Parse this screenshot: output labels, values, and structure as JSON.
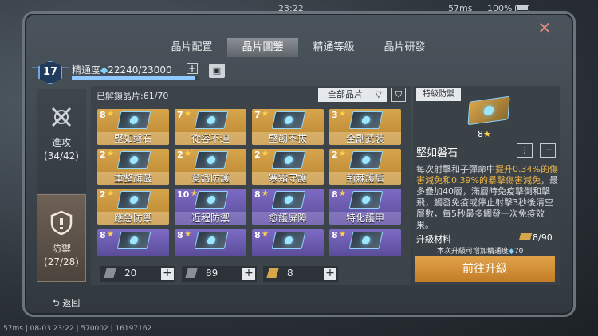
{
  "status": {
    "time": "23:22",
    "network": "57ms",
    "battery": "100%"
  },
  "tabs": [
    "晶片配置",
    "晶片圖鑒",
    "精通等級",
    "晶片研發"
  ],
  "active_tab": 1,
  "level": "17",
  "mastery": {
    "label": "精通度",
    "value": "22240/23000",
    "progress": 0.967
  },
  "categories": [
    {
      "name": "進攻",
      "count": "(34/42)"
    },
    {
      "name": "防禦",
      "count": "(27/28)"
    }
  ],
  "unlocked": "已解鎖晶片:61/70",
  "filter": "全部晶片",
  "chips": [
    {
      "level": "8",
      "name": "堅如磐石",
      "color": "gold"
    },
    {
      "level": "7",
      "name": "從容不迫",
      "color": "gold"
    },
    {
      "level": "7",
      "name": "堅韌不拔",
      "color": "gold"
    },
    {
      "level": "3",
      "name": "全副武裝",
      "color": "gold"
    },
    {
      "level": "2",
      "name": "重整旗鼓",
      "color": "gold"
    },
    {
      "level": "2",
      "name": "意識防護",
      "color": "gold"
    },
    {
      "level": "2",
      "name": "寒霜守護",
      "color": "gold"
    },
    {
      "level": "2",
      "name": "荊棘護盾",
      "color": "gold"
    },
    {
      "level": "2",
      "name": "應急防禦",
      "color": "gold"
    },
    {
      "level": "10",
      "name": "近程防禦",
      "color": "purple"
    },
    {
      "level": "8",
      "name": "愈護屏障",
      "color": "purple"
    },
    {
      "level": "8",
      "name": "特化護甲",
      "color": "purple"
    },
    {
      "level": "8",
      "name": "",
      "color": "purple"
    },
    {
      "level": "8",
      "name": "",
      "color": "purple"
    },
    {
      "level": "8",
      "name": "",
      "color": "purple"
    },
    {
      "level": "8",
      "name": "",
      "color": "purple"
    }
  ],
  "counters": [
    {
      "value": "20"
    },
    {
      "value": "89"
    },
    {
      "value": "8"
    }
  ],
  "detail": {
    "type": "特級防禦",
    "level": "8",
    "name": "堅如磐石",
    "desc_1": "每次射擊和子彈命中",
    "desc_hl1": "提升0.34%的傷害減免和0.39%的暴擊傷害減免",
    "desc_2": "，最多疊加40層，滿層時免疫擊倒和擊飛，觸發免疫或停止射擊3秒後清空層數，每5秒最多觸發一次免疫效果。",
    "upgrade_label": "升級材料",
    "upgrade_count": "8/90",
    "upgrade_note": "本次升級可增加精通度",
    "upgrade_note_value": "70",
    "upgrade_button": "前往升級"
  },
  "back": "返回",
  "footer": "57ms | 08-03 23:22 | 570002 | 16197162",
  "icons": {
    "close": "close-icon",
    "plus": "plus-icon",
    "filter": "filter-icon",
    "tree": "tree-icon",
    "more": "more-icon"
  },
  "colors": {
    "gold": "#d7a54c",
    "purple": "#7d6bc4",
    "accent": "#e2a24a",
    "mastery": "#8ec8ff"
  }
}
